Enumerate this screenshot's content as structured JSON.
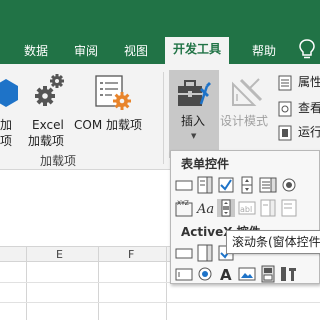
{
  "tabs": [
    {
      "label": "数据"
    },
    {
      "label": "审阅"
    },
    {
      "label": "视图"
    },
    {
      "label": "开发工具",
      "active": true
    },
    {
      "label": "帮助"
    }
  ],
  "ribbon": {
    "addins_partial": {
      "line1": "加",
      "line2": "项"
    },
    "excel_addins": {
      "line1": "Excel",
      "line2": "加载项"
    },
    "com_addins": {
      "label": "COM 加载项"
    },
    "group_addins_label": "加载项",
    "insert": {
      "label": "插入"
    },
    "design_mode": {
      "label": "设计模式"
    },
    "properties": {
      "label": "属性"
    },
    "view_code": {
      "label": "查看"
    },
    "run_dialog": {
      "label": "运行"
    }
  },
  "dropdown": {
    "form_controls_title": "表单控件",
    "activex_title": "ActiveX 控件"
  },
  "tooltip": {
    "text": "滚动条(窗体控件)"
  },
  "sheet": {
    "columns": [
      "E",
      "F"
    ]
  },
  "colors": {
    "ribbon_green": "#217346",
    "ribbon_bg": "#f3f3f3",
    "blue_icon": "#1e73c8",
    "orange_gear": "#e8842b"
  }
}
